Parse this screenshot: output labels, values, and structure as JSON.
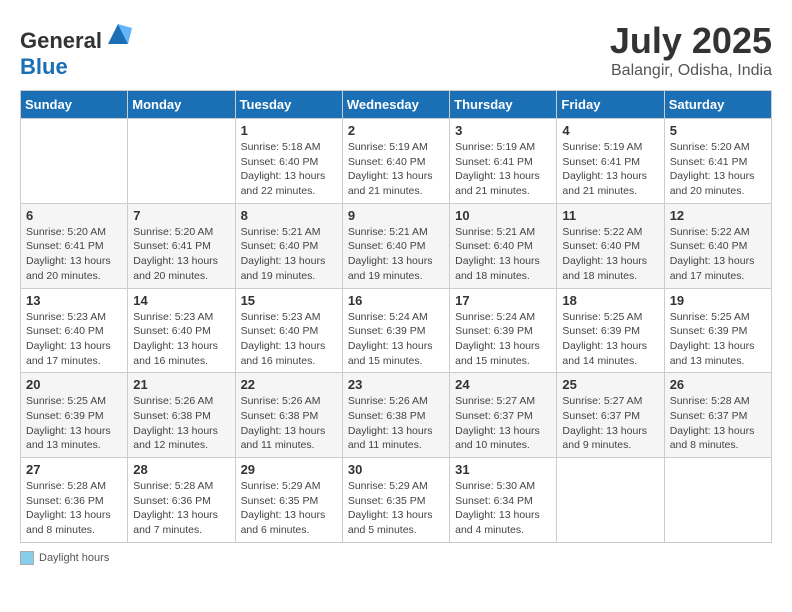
{
  "header": {
    "logo_general": "General",
    "logo_blue": "Blue",
    "title": "July 2025",
    "location": "Balangir, Odisha, India"
  },
  "days_of_week": [
    "Sunday",
    "Monday",
    "Tuesday",
    "Wednesday",
    "Thursday",
    "Friday",
    "Saturday"
  ],
  "weeks": [
    [
      {
        "day": "",
        "sunrise": "",
        "sunset": "",
        "daylight": ""
      },
      {
        "day": "",
        "sunrise": "",
        "sunset": "",
        "daylight": ""
      },
      {
        "day": "1",
        "sunrise": "5:18 AM",
        "sunset": "6:40 PM",
        "daylight": "13 hours and 22 minutes."
      },
      {
        "day": "2",
        "sunrise": "5:19 AM",
        "sunset": "6:40 PM",
        "daylight": "13 hours and 21 minutes."
      },
      {
        "day": "3",
        "sunrise": "5:19 AM",
        "sunset": "6:41 PM",
        "daylight": "13 hours and 21 minutes."
      },
      {
        "day": "4",
        "sunrise": "5:19 AM",
        "sunset": "6:41 PM",
        "daylight": "13 hours and 21 minutes."
      },
      {
        "day": "5",
        "sunrise": "5:20 AM",
        "sunset": "6:41 PM",
        "daylight": "13 hours and 20 minutes."
      }
    ],
    [
      {
        "day": "6",
        "sunrise": "5:20 AM",
        "sunset": "6:41 PM",
        "daylight": "13 hours and 20 minutes."
      },
      {
        "day": "7",
        "sunrise": "5:20 AM",
        "sunset": "6:41 PM",
        "daylight": "13 hours and 20 minutes."
      },
      {
        "day": "8",
        "sunrise": "5:21 AM",
        "sunset": "6:40 PM",
        "daylight": "13 hours and 19 minutes."
      },
      {
        "day": "9",
        "sunrise": "5:21 AM",
        "sunset": "6:40 PM",
        "daylight": "13 hours and 19 minutes."
      },
      {
        "day": "10",
        "sunrise": "5:21 AM",
        "sunset": "6:40 PM",
        "daylight": "13 hours and 18 minutes."
      },
      {
        "day": "11",
        "sunrise": "5:22 AM",
        "sunset": "6:40 PM",
        "daylight": "13 hours and 18 minutes."
      },
      {
        "day": "12",
        "sunrise": "5:22 AM",
        "sunset": "6:40 PM",
        "daylight": "13 hours and 17 minutes."
      }
    ],
    [
      {
        "day": "13",
        "sunrise": "5:23 AM",
        "sunset": "6:40 PM",
        "daylight": "13 hours and 17 minutes."
      },
      {
        "day": "14",
        "sunrise": "5:23 AM",
        "sunset": "6:40 PM",
        "daylight": "13 hours and 16 minutes."
      },
      {
        "day": "15",
        "sunrise": "5:23 AM",
        "sunset": "6:40 PM",
        "daylight": "13 hours and 16 minutes."
      },
      {
        "day": "16",
        "sunrise": "5:24 AM",
        "sunset": "6:39 PM",
        "daylight": "13 hours and 15 minutes."
      },
      {
        "day": "17",
        "sunrise": "5:24 AM",
        "sunset": "6:39 PM",
        "daylight": "13 hours and 15 minutes."
      },
      {
        "day": "18",
        "sunrise": "5:25 AM",
        "sunset": "6:39 PM",
        "daylight": "13 hours and 14 minutes."
      },
      {
        "day": "19",
        "sunrise": "5:25 AM",
        "sunset": "6:39 PM",
        "daylight": "13 hours and 13 minutes."
      }
    ],
    [
      {
        "day": "20",
        "sunrise": "5:25 AM",
        "sunset": "6:39 PM",
        "daylight": "13 hours and 13 minutes."
      },
      {
        "day": "21",
        "sunrise": "5:26 AM",
        "sunset": "6:38 PM",
        "daylight": "13 hours and 12 minutes."
      },
      {
        "day": "22",
        "sunrise": "5:26 AM",
        "sunset": "6:38 PM",
        "daylight": "13 hours and 11 minutes."
      },
      {
        "day": "23",
        "sunrise": "5:26 AM",
        "sunset": "6:38 PM",
        "daylight": "13 hours and 11 minutes."
      },
      {
        "day": "24",
        "sunrise": "5:27 AM",
        "sunset": "6:37 PM",
        "daylight": "13 hours and 10 minutes."
      },
      {
        "day": "25",
        "sunrise": "5:27 AM",
        "sunset": "6:37 PM",
        "daylight": "13 hours and 9 minutes."
      },
      {
        "day": "26",
        "sunrise": "5:28 AM",
        "sunset": "6:37 PM",
        "daylight": "13 hours and 8 minutes."
      }
    ],
    [
      {
        "day": "27",
        "sunrise": "5:28 AM",
        "sunset": "6:36 PM",
        "daylight": "13 hours and 8 minutes."
      },
      {
        "day": "28",
        "sunrise": "5:28 AM",
        "sunset": "6:36 PM",
        "daylight": "13 hours and 7 minutes."
      },
      {
        "day": "29",
        "sunrise": "5:29 AM",
        "sunset": "6:35 PM",
        "daylight": "13 hours and 6 minutes."
      },
      {
        "day": "30",
        "sunrise": "5:29 AM",
        "sunset": "6:35 PM",
        "daylight": "13 hours and 5 minutes."
      },
      {
        "day": "31",
        "sunrise": "5:30 AM",
        "sunset": "6:34 PM",
        "daylight": "13 hours and 4 minutes."
      },
      {
        "day": "",
        "sunrise": "",
        "sunset": "",
        "daylight": ""
      },
      {
        "day": "",
        "sunrise": "",
        "sunset": "",
        "daylight": ""
      }
    ]
  ],
  "footer": {
    "daylight_label": "Daylight hours"
  }
}
